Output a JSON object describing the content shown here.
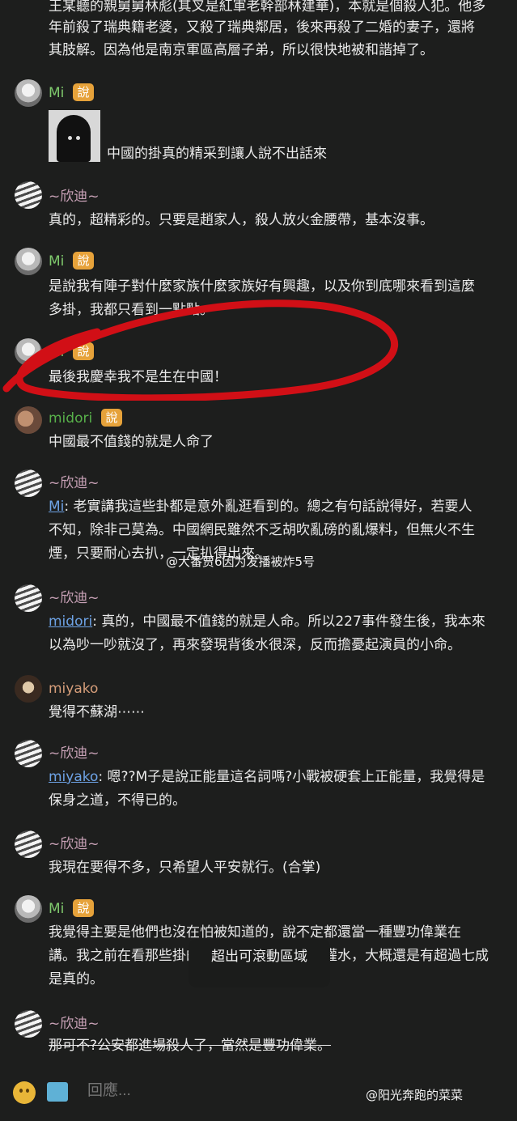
{
  "top_partial": {
    "lines": [
      "王某聽的親舅舅林彪(其叉是紅軍老幹部林建華)，本就是個殺人犯。他多",
      "年前殺了瑞典籍老婆，又殺了瑞典鄰居，後來再殺了二婚的妻子，還將",
      "其肢解。因為他是南京軍區高層子弟，所以很快地被和諧掉了。"
    ]
  },
  "messages": [
    {
      "author": "Mi",
      "badge": "說",
      "kind": "image",
      "text": "中國的掛真的精采到讓人說不出話來"
    },
    {
      "author": "~欣迪~",
      "text": "真的，超精彩的。只要是趙家人，殺人放火金腰帶，基本沒事。"
    },
    {
      "author": "Mi",
      "badge": "說",
      "lines": [
        "是說我有陣子對什麼家族什麼家族好有興趣，以及你到底哪來看到這麼",
        "多掛，我都只看到一點點。"
      ]
    },
    {
      "author": "Mi",
      "badge": "說",
      "text": "最後我慶幸我不是生在中國！"
    },
    {
      "author": "midori",
      "badge": "說",
      "text": "中國最不值錢的就是人命了"
    },
    {
      "author": "~欣迪~",
      "mention": "Mi",
      "lines": [
        ": 老實講我這些卦都是意外亂逛看到的。總之有句話說得好，若要人",
        "不知，除非己莫為。中國網民雖然不乏胡吹亂磅的亂爆料，但無火不生",
        "煙，只要耐心去扒，一定扒得出來。"
      ]
    },
    {
      "author": "~欣迪~",
      "mention": "midori",
      "lines": [
        ": 真的，中國最不值錢的就是人命。所以227事件發生後，我本來",
        "以為吵一吵就沒了，再來發現背後水很深，反而擔憂起演員的小命。"
      ]
    },
    {
      "author": "miyako",
      "text": "覺得不蘇湖⋯⋯"
    },
    {
      "author": "~欣迪~",
      "mention": "miyako",
      "lines": [
        ": 嗯??M子是說正能量這名詞嗎?小戰被硬套上正能量，我覺得是",
        "保身之道，不得已的。"
      ]
    },
    {
      "author": "~欣迪~",
      "text": "我現在要得不多，只希望人平安就行。(合掌)"
    },
    {
      "author": "Mi",
      "badge": "說",
      "lines": [
        "我覺得主要是他們也沒在怕被知道的，說不定都還當一種豐功偉業在",
        "講。我之前在看那些掛的時候也發現，雖然有灌水，大概還是有超過七成",
        "是真的。"
      ]
    },
    {
      "author": "~欣迪~",
      "text": "那可不?公安都進場殺人了，當然是豐功偉業。"
    }
  ],
  "watermark_mid": "@大番贾6因为发播被炸5号",
  "toast": "超出可滾動區域",
  "input_placeholder": "回應...",
  "watermark_bottom": "@阳光奔跑的菜菜",
  "colors": {
    "background": "#1d1e1d",
    "mi": "#7ec86c",
    "xin": "#c9a2b7",
    "midori": "#58b14a",
    "miyako": "#d69e7a",
    "badge": "#e6a23a",
    "mention": "#6ea3e6",
    "oval": "#d10f16"
  }
}
